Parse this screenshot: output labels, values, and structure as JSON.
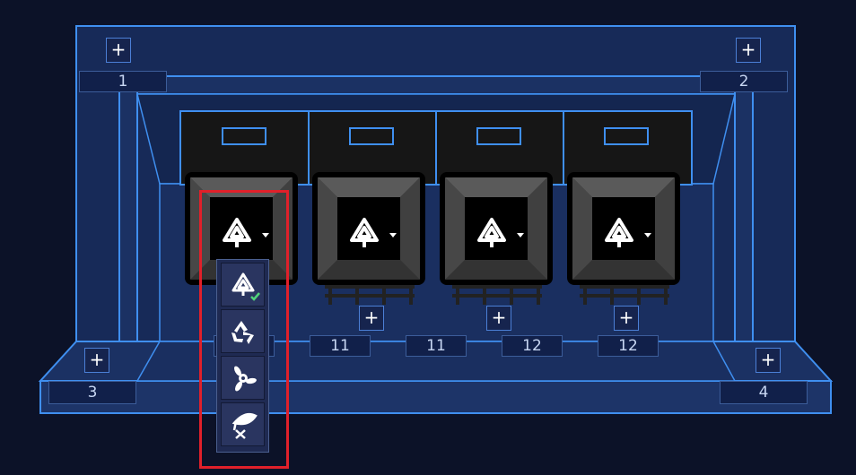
{
  "colors": {
    "background": "#0c1228",
    "frame": "#1b3163",
    "frame_line": "#3f8ff0",
    "highlight": "#e0202a",
    "check": "#52d37a"
  },
  "corner_buttons": [
    {
      "symbol": "+",
      "label": "1"
    },
    {
      "symbol": "+",
      "label": "2"
    },
    {
      "symbol": "+",
      "label": "3"
    },
    {
      "symbol": "+",
      "label": "4"
    }
  ],
  "bins": [
    {
      "icon": "general-waste-icon",
      "dropdown": "caret-down-icon"
    },
    {
      "icon": "general-waste-icon",
      "dropdown": "caret-down-icon"
    },
    {
      "icon": "general-waste-icon",
      "dropdown": "caret-down-icon"
    },
    {
      "icon": "general-waste-icon",
      "dropdown": "caret-down-icon"
    }
  ],
  "bin_buttons": {
    "symbol": "+"
  },
  "bin_labels": [
    "11",
    "11",
    "11",
    "12",
    "12"
  ],
  "waste_menu": {
    "items": [
      {
        "icon": "general-waste-icon",
        "selected": true
      },
      {
        "icon": "recyclable-icon",
        "selected": false
      },
      {
        "icon": "hazardous-waste-icon",
        "selected": false
      },
      {
        "icon": "food-waste-icon",
        "selected": false
      }
    ]
  }
}
